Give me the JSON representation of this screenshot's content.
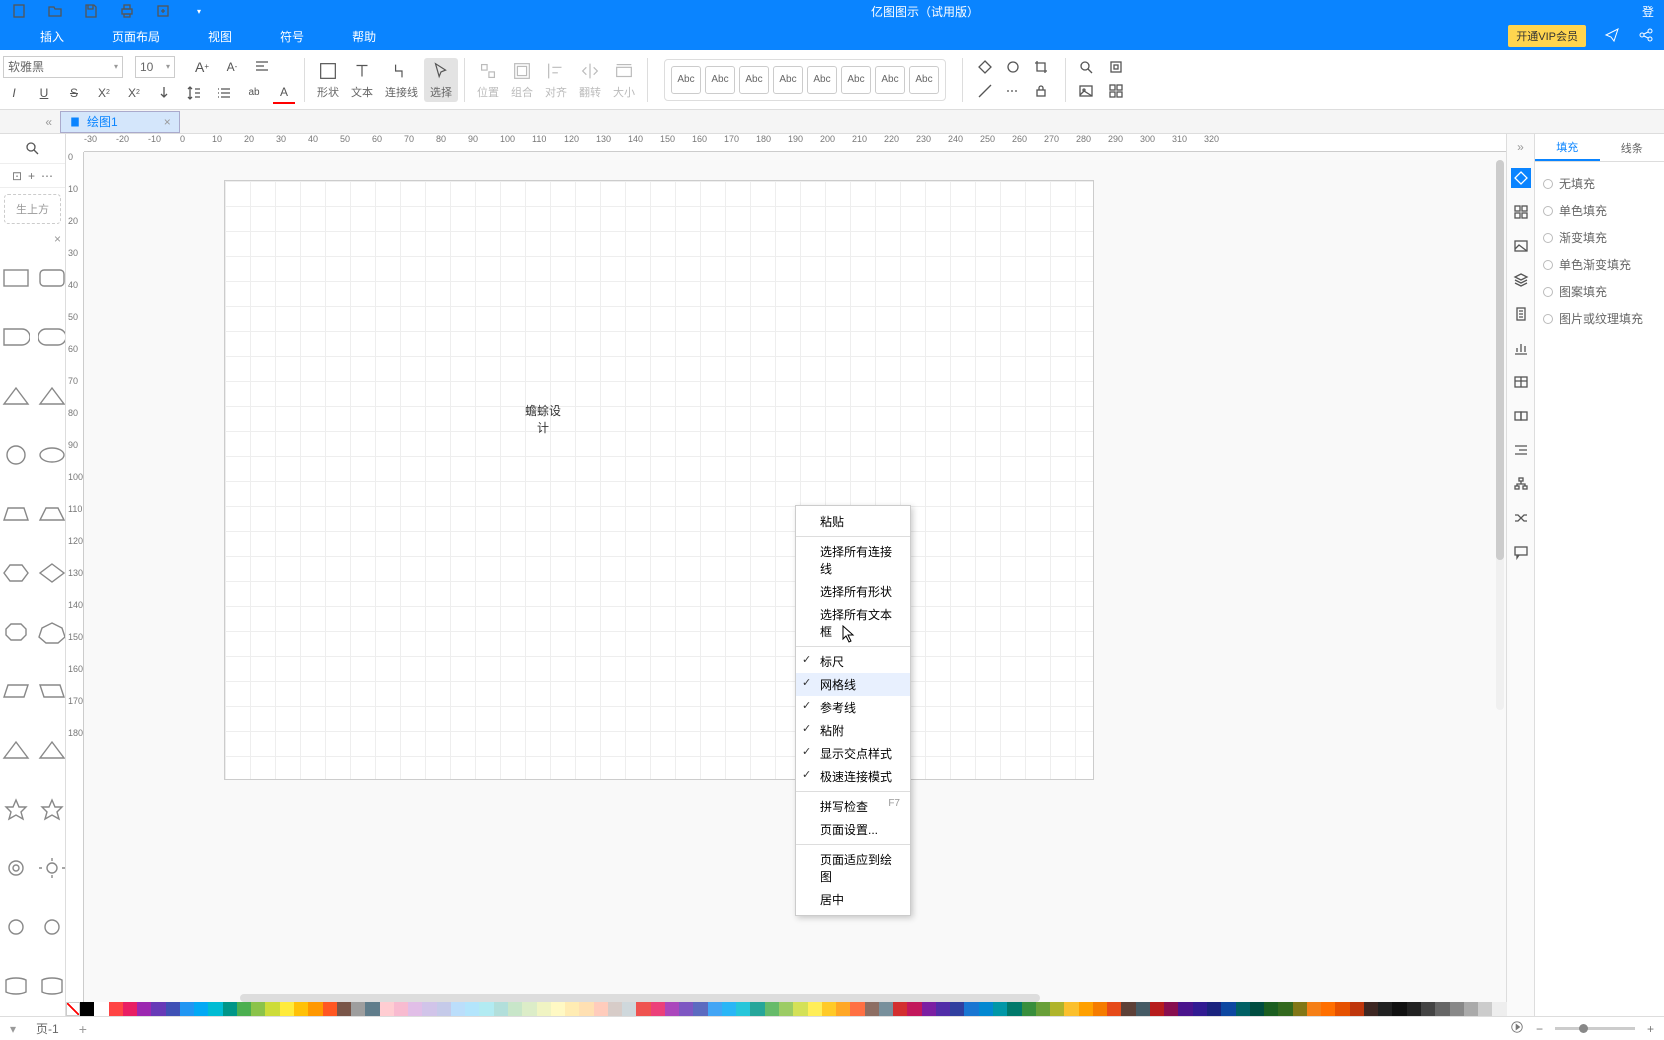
{
  "app": {
    "title": "亿图图示（试用版）"
  },
  "menus": [
    "插入",
    "页面布局",
    "视图",
    "符号",
    "帮助"
  ],
  "vip": "开通VIP会员",
  "font": {
    "name": "软雅黑",
    "size": "10"
  },
  "bigtools": {
    "shape": "形状",
    "text": "文本",
    "conn": "连接线",
    "select": "选择",
    "pos": "位置",
    "group": "组合",
    "align": "对齐",
    "flip": "翻转",
    "size": "大小"
  },
  "abc": "Abc",
  "doc_tab": "绘图1",
  "hint": "生上方",
  "canvas_text": {
    "l1": "蟾蜍设",
    "l2": "计"
  },
  "ctx": {
    "paste": "粘贴",
    "sel_conn": "选择所有连接线",
    "sel_shape": "选择所有形状",
    "sel_text": "选择所有文本框",
    "ruler": "标尺",
    "grid": "网格线",
    "guide": "参考线",
    "snap": "粘附",
    "inter": "显示交点样式",
    "fast": "极速连接模式",
    "spell": "拼写检查",
    "spell_sc": "F7",
    "pageset": "页面设置...",
    "fit": "页面适应到绘图",
    "center": "居中"
  },
  "prop": {
    "fill": "填充",
    "line": "线条",
    "none": "无填充",
    "solid": "单色填充",
    "grad": "渐变填充",
    "sgrad": "单色渐变填充",
    "pattern": "图案填充",
    "img": "图片或纹理填充"
  },
  "page_name": "页-1",
  "ruler_h": [
    -30,
    -20,
    -10,
    0,
    10,
    20,
    30,
    40,
    50,
    60,
    70,
    80,
    90,
    100,
    110,
    120,
    130,
    140,
    150,
    160,
    170,
    180,
    190,
    200,
    210,
    220,
    230,
    240,
    250,
    260,
    270,
    280,
    290,
    300,
    310,
    320
  ],
  "ruler_v": [
    0,
    10,
    20,
    30,
    40,
    50,
    60,
    70,
    80,
    90,
    100,
    110,
    120,
    130,
    140,
    150,
    160,
    170,
    180
  ],
  "colors": [
    "#000",
    "#fff",
    "#f44",
    "#e91e63",
    "#9c27b0",
    "#673ab7",
    "#3f51b5",
    "#2196f3",
    "#03a9f4",
    "#00bcd4",
    "#009688",
    "#4caf50",
    "#8bc34a",
    "#cddc39",
    "#ffeb3b",
    "#ffc107",
    "#ff9800",
    "#ff5722",
    "#795548",
    "#9e9e9e",
    "#607d8b",
    "#ffcdd2",
    "#f8bbd0",
    "#e1bee7",
    "#d1c4e9",
    "#c5cae9",
    "#bbdefb",
    "#b3e5fc",
    "#b2ebf2",
    "#b2dfdb",
    "#c8e6c9",
    "#dcedc8",
    "#f0f4c3",
    "#fff9c4",
    "#ffecb3",
    "#ffe0b2",
    "#ffccbc",
    "#d7ccc8",
    "#cfd8dc",
    "#ef5350",
    "#ec407a",
    "#ab47bc",
    "#7e57c2",
    "#5c6bc0",
    "#42a5f5",
    "#29b6f6",
    "#26c6da",
    "#26a69a",
    "#66bb6a",
    "#9ccc65",
    "#d4e157",
    "#ffee58",
    "#ffca28",
    "#ffa726",
    "#ff7043",
    "#8d6e63",
    "#78909c",
    "#d32f2f",
    "#c2185b",
    "#7b1fa2",
    "#512da8",
    "#303f9f",
    "#1976d2",
    "#0288d1",
    "#0097a7",
    "#00796b",
    "#388e3c",
    "#689f38",
    "#afb42b",
    "#fbc02d",
    "#ffa000",
    "#f57c00",
    "#e64a19",
    "#5d4037",
    "#455a64",
    "#b71c1c",
    "#880e4f",
    "#4a148c",
    "#311b92",
    "#1a237e",
    "#0d47a1",
    "#006064",
    "#004d40",
    "#1b5e20",
    "#33691e",
    "#827717",
    "#f57f17",
    "#ff6f00",
    "#e65100",
    "#bf360c",
    "#3e2723",
    "#212121",
    "#111",
    "#222",
    "#444",
    "#666",
    "#888",
    "#aaa",
    "#ccc",
    "#eee"
  ]
}
